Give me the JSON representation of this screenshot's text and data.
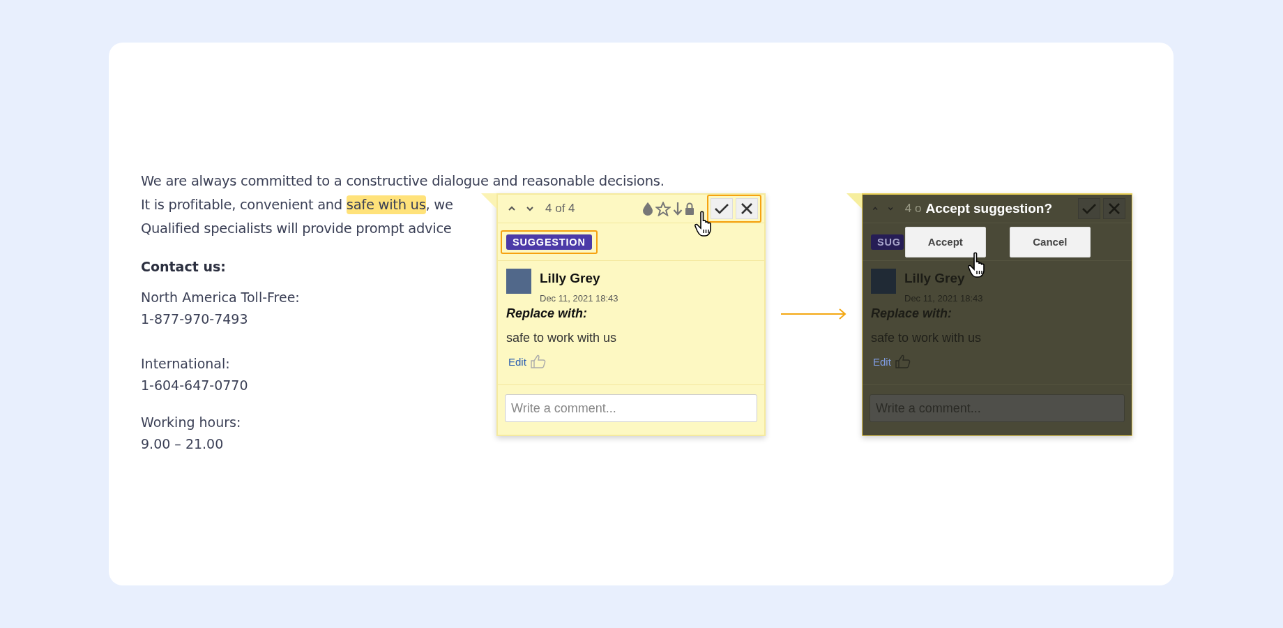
{
  "document": {
    "lines": [
      {
        "text": "We are always committed to a constructive dialogue and reasonable decisions."
      },
      {
        "text": "It is profitable, convenient and ",
        "highlight": "safe with us",
        "after": ", we"
      },
      {
        "text": "Qualified specialists will provide prompt advice"
      }
    ],
    "contact_heading": "Contact us:",
    "contacts": [
      {
        "label": "North America Toll-Free:",
        "value": "1-877-970-7493"
      },
      {
        "label": "International:",
        "value": "1-604-647-0770"
      },
      {
        "label": "Working hours:",
        "value": "9.00 – 21.00"
      }
    ]
  },
  "popups": [
    {
      "kind": "comment",
      "counter": "4 of 4",
      "badge": "SUGGESTION",
      "badge_outlined": true,
      "actions_outlined": true,
      "author": "Lilly Grey",
      "date": "Dec 11, 2021 18:43",
      "action_label": "Replace with:",
      "replacement": "safe to work with us",
      "edit_link": "Edit",
      "comment_placeholder": "Write a comment..."
    },
    {
      "kind": "confirm",
      "counter": "4 o",
      "title": "Accept suggestion?",
      "badge": "SUG",
      "buttons": [
        {
          "label": "Accept"
        },
        {
          "label": "Cancel"
        }
      ],
      "author": "Lilly Grey",
      "date": "Dec 11, 2021 18:43",
      "action_label": "Replace with:",
      "replacement": "safe to work with us",
      "edit_link": "Edit",
      "comment_placeholder": "Write a comment..."
    }
  ]
}
